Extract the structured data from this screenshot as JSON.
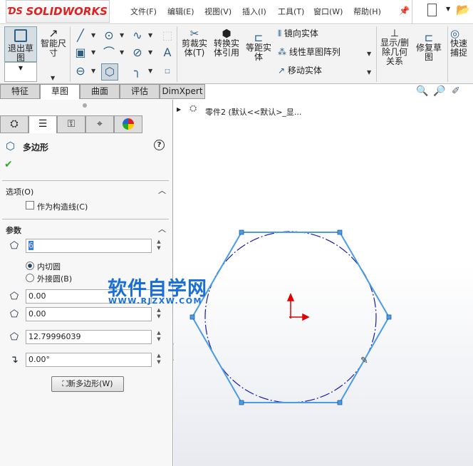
{
  "app": {
    "logo": "SOLIDWORKS"
  },
  "menu": [
    "文件(F)",
    "编辑(E)",
    "视图(V)",
    "插入(I)",
    "工具(T)",
    "窗口(W)",
    "帮助(H)"
  ],
  "ribbon": {
    "exit_sketch": "退出草图",
    "smart_dim": "智能尺寸",
    "trim": "剪裁实体(T)",
    "convert": "转换实体引用",
    "offset": "等距实体",
    "mirror": "镜向实体",
    "linear_pattern": "线性草图阵列",
    "move": "移动实体",
    "show_relations": "显示/删除几何关系",
    "repair": "修复草图",
    "quick_snap": "快速捕捉"
  },
  "tabs": [
    "特征",
    "草图",
    "曲面",
    "评估",
    "DimXpert"
  ],
  "active_tab": "草图",
  "tree": {
    "label": "零件2  (默认<<默认>_显..."
  },
  "panel": {
    "title": "多边形",
    "options_header": "选项(O)",
    "construction_label": "作为构造线(C)",
    "construction_checked": false,
    "params_header": "参数",
    "sides": "6",
    "inscribed": "内切圆",
    "circumscribed": "外接圆(B)",
    "selected": "内切圆",
    "center_x": "0.00",
    "center_y": "0.00",
    "diameter": "12.79996039",
    "angle": "0.00°",
    "new_polygon": "新多边形(W)"
  },
  "watermark": {
    "title": "软件自学网",
    "url": "WWW.RJZXW.COM"
  },
  "colors": {
    "sketch": "#4a9be8",
    "circle": "#1a1ab0",
    "origin": "#e00000",
    "watermark": "#1a6fd6"
  }
}
